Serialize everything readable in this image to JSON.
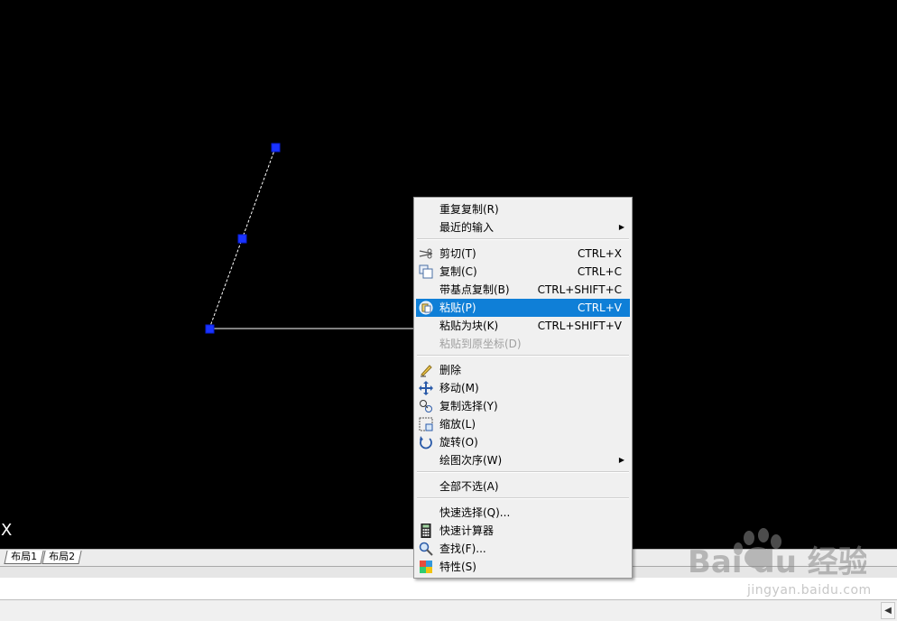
{
  "canvas": {
    "axis_label": "X"
  },
  "layout_tabs": [
    {
      "label": "布局1"
    },
    {
      "label": "布局2"
    }
  ],
  "context_menu": {
    "items": [
      {
        "label": "重复复制(R)",
        "shortcut": ""
      },
      {
        "label": "最近的输入",
        "shortcut": "",
        "submenu": true
      },
      {
        "label": "剪切(T)",
        "shortcut": "CTRL+X",
        "icon": "scissors-icon"
      },
      {
        "label": "复制(C)",
        "shortcut": "CTRL+C",
        "icon": "copy-icon"
      },
      {
        "label": "带基点复制(B)",
        "shortcut": "CTRL+SHIFT+C"
      },
      {
        "label": "粘贴(P)",
        "shortcut": "CTRL+V",
        "icon": "paste-icon",
        "highlighted": true
      },
      {
        "label": "粘贴为块(K)",
        "shortcut": "CTRL+SHIFT+V"
      },
      {
        "label": "粘贴到原坐标(D)",
        "shortcut": "",
        "disabled": true
      },
      {
        "label": "删除",
        "shortcut": "",
        "icon": "eraser-icon"
      },
      {
        "label": "移动(M)",
        "shortcut": "",
        "icon": "move-icon"
      },
      {
        "label": "复制选择(Y)",
        "shortcut": "",
        "icon": "copy-selection-icon"
      },
      {
        "label": "缩放(L)",
        "shortcut": "",
        "icon": "scale-icon"
      },
      {
        "label": "旋转(O)",
        "shortcut": "",
        "icon": "rotate-icon"
      },
      {
        "label": "绘图次序(W)",
        "shortcut": "",
        "submenu": true
      },
      {
        "label": "全部不选(A)",
        "shortcut": ""
      },
      {
        "label": "快速选择(Q)...",
        "shortcut": ""
      },
      {
        "label": "快速计算器",
        "shortcut": "",
        "icon": "calculator-icon"
      },
      {
        "label": "查找(F)...",
        "shortcut": "",
        "icon": "find-icon"
      },
      {
        "label": "特性(S)",
        "shortcut": "",
        "icon": "properties-icon"
      }
    ]
  },
  "watermark": {
    "brand": "Bai du 经验",
    "url": "jingyan.baidu.com"
  },
  "colors": {
    "canvas_bg": "#000000",
    "grip": "#1a33ff",
    "menu_highlight": "#0f7fd7"
  }
}
